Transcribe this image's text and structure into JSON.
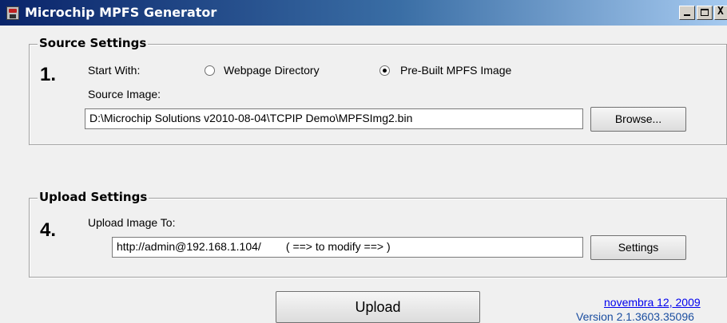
{
  "window": {
    "title": "Microchip MPFS Generator",
    "controls": {
      "minimize": "_",
      "maximize": "□",
      "close": "X"
    }
  },
  "source_settings": {
    "title": "Source Settings",
    "step": "1.",
    "start_with_label": "Start With:",
    "options": [
      {
        "label": "Webpage Directory",
        "checked": false
      },
      {
        "label": "Pre-Built MPFS Image",
        "checked": true
      }
    ],
    "source_image_label": "Source Image:",
    "source_image_value": "D:\\Microchip Solutions v2010-08-04\\TCPIP Demo\\MPFSImg2.bin",
    "browse_label": "Browse..."
  },
  "upload_settings": {
    "title": "Upload Settings",
    "step": "4.",
    "upload_to_label": "Upload Image To:",
    "upload_to_value": "http://admin@192.168.1.104/        ( ==> to modify ==> )",
    "settings_label": "Settings"
  },
  "footer": {
    "upload_label": "Upload",
    "date_link": "novembra 12, 2009",
    "version": "Version 2.1.3603.35096"
  }
}
